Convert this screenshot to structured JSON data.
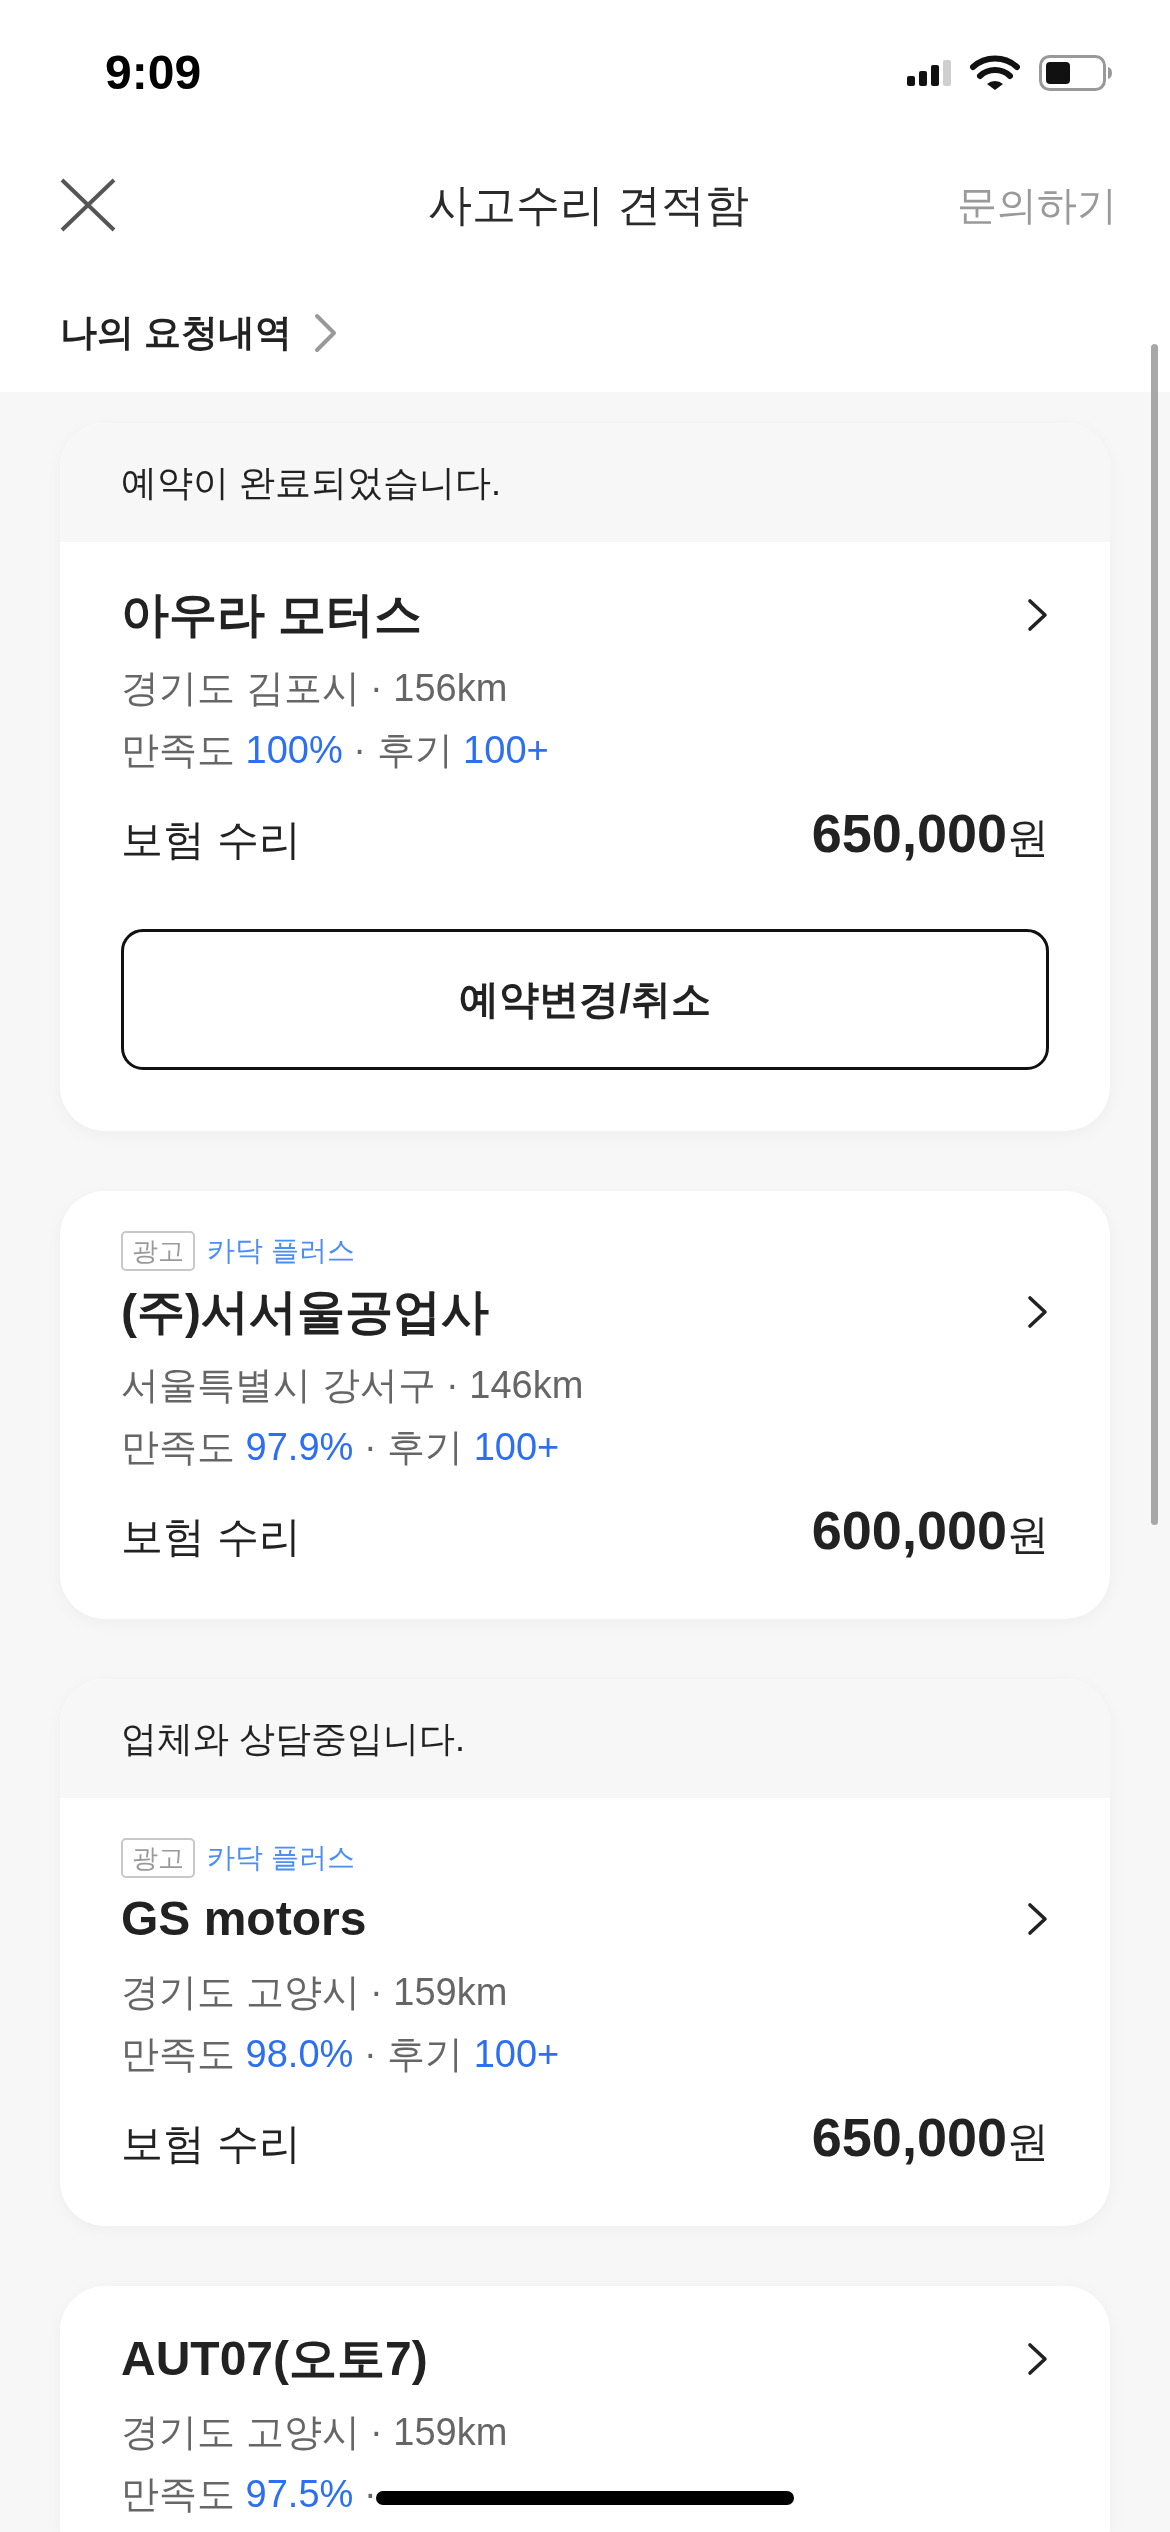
{
  "status_bar": {
    "time": "9:09"
  },
  "header": {
    "title": "사고수리 견적함",
    "action": "문의하기"
  },
  "my_requests": {
    "label": "나의 요청내역"
  },
  "cards": [
    {
      "status_message": "예약이 완료되었습니다.",
      "name": "아우라 모터스",
      "address": "경기도 김포시 · 156km",
      "rating": {
        "label": "만족도",
        "value": "100%",
        "separator": "·",
        "reviews_label": "후기",
        "reviews": "100+"
      },
      "service": "보험 수리",
      "price": "650,000",
      "currency": "원",
      "button": "예약변경/취소"
    },
    {
      "ad": {
        "tag": "광고",
        "brand": "카닥 플러스"
      },
      "name": "(주)서서울공업사",
      "address": "서울특별시 강서구 · 146km",
      "rating": {
        "label": "만족도",
        "value": "97.9%",
        "separator": "·",
        "reviews_label": "후기",
        "reviews": "100+"
      },
      "service": "보험 수리",
      "price": "600,000",
      "currency": "원"
    },
    {
      "status_message": "업체와 상담중입니다.",
      "ad": {
        "tag": "광고",
        "brand": "카닥 플러스"
      },
      "name": "GS motors",
      "address": "경기도 고양시 · 159km",
      "rating": {
        "label": "만족도",
        "value": "98.0%",
        "separator": "·",
        "reviews_label": "후기",
        "reviews": "100+"
      },
      "service": "보험 수리",
      "price": "650,000",
      "currency": "원"
    },
    {
      "name": "AUT07(오토7)",
      "address": "경기도 고양시 · 159km",
      "rating": {
        "label": "만족도",
        "value": "97.5%",
        "separator": "·"
      }
    }
  ]
}
